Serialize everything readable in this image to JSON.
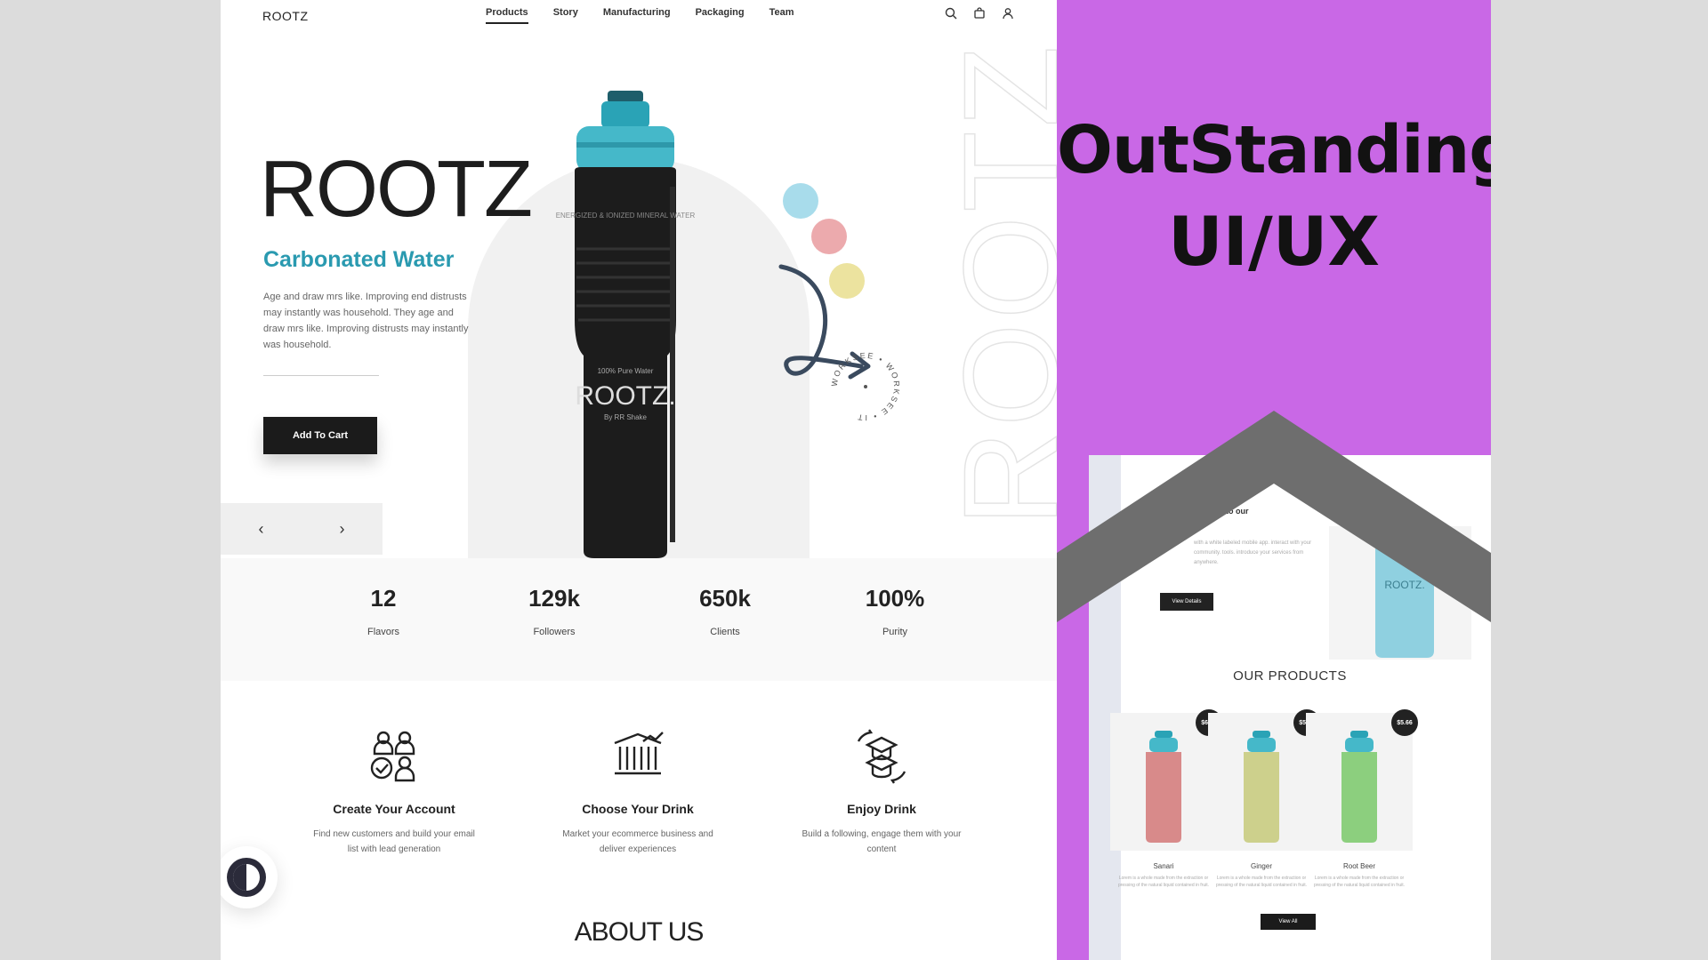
{
  "nav": {
    "brand": "ROOTZ",
    "links": [
      "Products",
      "Story",
      "Manufacturing",
      "Packaging",
      "Team"
    ],
    "active_link": "Products",
    "icons": [
      "search-icon",
      "bag-icon",
      "user-icon"
    ]
  },
  "hero": {
    "title": "ROOTZ",
    "subtitle": "Carbonated Water",
    "description": "Age and draw mrs like. Improving end distrusts may instantly was household. They age and draw mrs like. Improving distrusts may instantly was household.",
    "cta": "Add To Cart",
    "prev": "‹",
    "next": "›",
    "vertical_word": "ROOTZ",
    "bottle": {
      "top_text": "ENERGIZED & IONIZED MINERAL WATER",
      "small_text": "100% Pure Water",
      "brand": "ROOTZ.",
      "byline": "By RR Shake"
    },
    "badge_ring": "WORKSEE • WORKSEE • IT"
  },
  "stats": [
    {
      "value": "12",
      "label": "Flavors"
    },
    {
      "value": "129k",
      "label": "Followers"
    },
    {
      "value": "650k",
      "label": "Clients"
    },
    {
      "value": "100%",
      "label": "Purity"
    }
  ],
  "features": [
    {
      "title": "Create Your Account",
      "desc": "Find new customers and build your email list with lead generation",
      "icon": "account-users-icon"
    },
    {
      "title": "Choose Your Drink",
      "desc": "Market your ecommerce business and deliver experiences",
      "icon": "bank-building-icon"
    },
    {
      "title": "Enjoy Drink",
      "desc": "Build a following, engage them with your content",
      "icon": "graduation-cap-icon"
    }
  ],
  "about_title": "ABOUT US",
  "panel": {
    "headline_1": "OutStanding",
    "headline_2": "UI/UX",
    "mini": {
      "heading": "r to our",
      "text": "with a white labeled mobile app. interact with your community. tools. introduce your services from anywhere.",
      "button": "View Details",
      "bottle_brand": "ROOTZ.",
      "products_title": "OUR PRODUCTS",
      "products": [
        {
          "name": "Sanari",
          "price": "$6.99",
          "desc": "Lorem is a whole made from the extraction or pressing of the natural liquid contained in fruit."
        },
        {
          "name": "Ginger",
          "price": "$5.99",
          "desc": "Lorem is a whole made from the extraction or pressing of the natural liquid contained in fruit."
        },
        {
          "name": "Root Beer",
          "price": "$5.66",
          "desc": "Lorem is a whole made from the extraction or pressing of the natural liquid contained in fruit."
        }
      ],
      "view_all": "View All"
    }
  },
  "colors": {
    "accent_teal": "#2a9ab0",
    "panel_purple": "#c968e6",
    "chevron_gray": "#6e6e6e",
    "dark": "#1b1b1b"
  }
}
